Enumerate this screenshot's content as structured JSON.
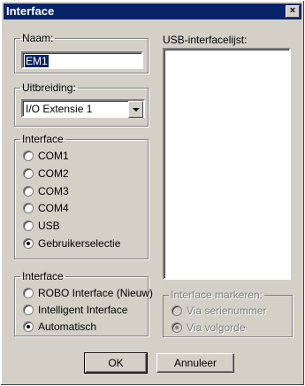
{
  "window": {
    "title": "Interface",
    "close_glyph": "×"
  },
  "naam": {
    "label": "Naam:",
    "value": "EM1"
  },
  "uitbreiding": {
    "label": "Uitbreiding:",
    "selected": "I/O Extensie 1"
  },
  "usb_list": {
    "label": "USB-interfacelijst:"
  },
  "interface_ports": {
    "label": "Interface",
    "options": [
      {
        "label": "COM1",
        "checked": false
      },
      {
        "label": "COM2",
        "checked": false
      },
      {
        "label": "COM3",
        "checked": false
      },
      {
        "label": "COM4",
        "checked": false
      },
      {
        "label": "USB",
        "checked": false
      },
      {
        "label": "Gebruikerselectie",
        "checked": true
      }
    ]
  },
  "interface_type": {
    "label": "Interface",
    "options": [
      {
        "label": "ROBO Interface (Nieuw)",
        "checked": false
      },
      {
        "label": "Intelligent Interface",
        "checked": false
      },
      {
        "label": "Automatisch",
        "checked": true
      }
    ]
  },
  "interface_markeren": {
    "label": "Interface markeren:",
    "options": [
      {
        "label": "Via serienummer",
        "checked": false
      },
      {
        "label": "Via volgorde",
        "checked": true
      }
    ]
  },
  "buttons": {
    "ok": "OK",
    "cancel": "Annuleer"
  }
}
